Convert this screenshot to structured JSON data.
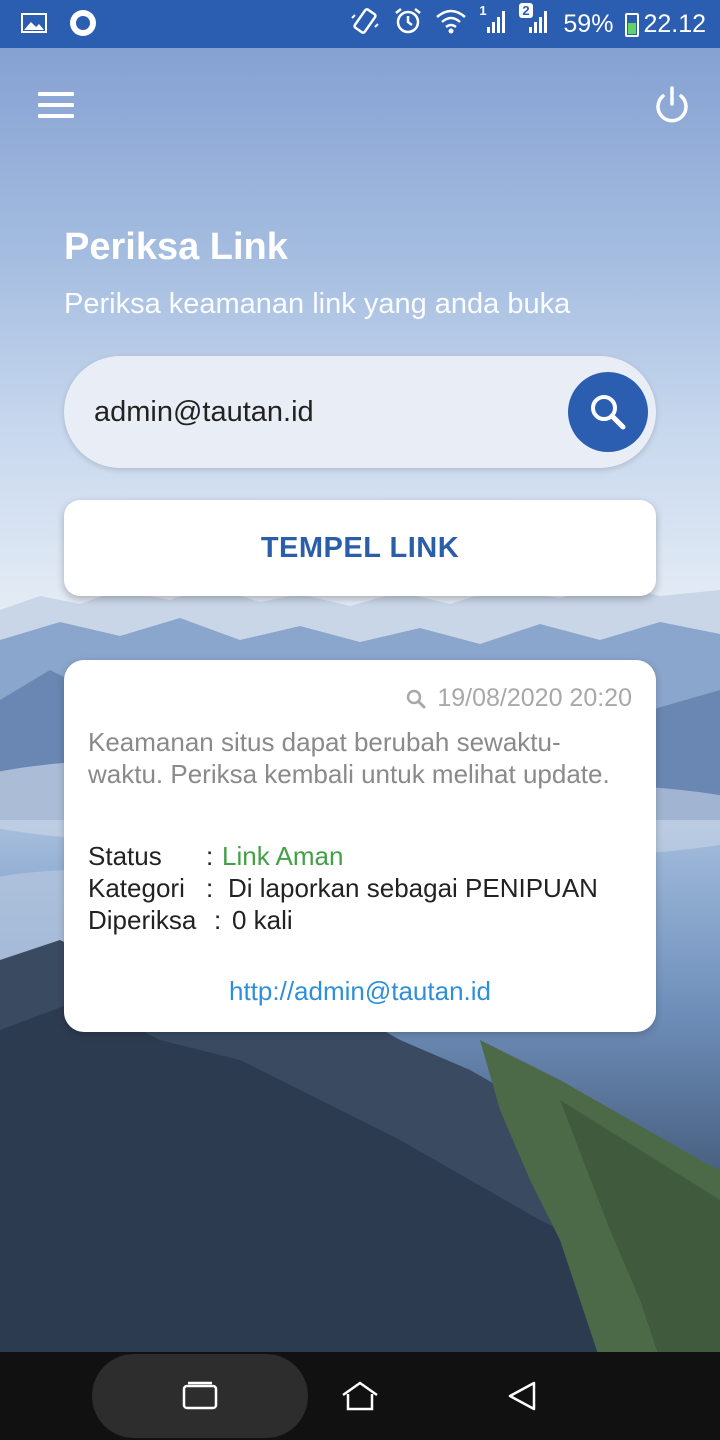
{
  "status_bar": {
    "battery": "59%",
    "time": "22.12",
    "sim_badge_1": "1",
    "sim_badge_2": "2",
    "icons": [
      "image-icon",
      "circle-app-icon",
      "vibrate-icon",
      "alarm-icon",
      "wifi-icon",
      "signal-icon",
      "signal-icon",
      "battery-icon"
    ]
  },
  "app_bar": {
    "menu_icon": "hamburger-menu-icon",
    "power_icon": "power-icon"
  },
  "header": {
    "title": "Periksa Link",
    "subtitle": "Periksa keamanan link yang anda buka"
  },
  "search": {
    "value": "admin@tautan.id",
    "icon": "search-icon"
  },
  "paste_button": {
    "label": "TEMPEL LINK"
  },
  "result_card": {
    "timestamp": "19/08/2020 20:20",
    "note": "Keamanan situs dapat berubah sewaktu-waktu. Periksa kembali untuk melihat update.",
    "rows": [
      {
        "key": "Status",
        "sep": ":",
        "value": "Link Aman"
      },
      {
        "key": "Kategori",
        "sep": ":",
        "value": "Di laporkan sebagai PENIPUAN"
      },
      {
        "key": "Diperiksa",
        "sep": ":",
        "value": "0 kali"
      }
    ],
    "link": "http://admin@tautan.id"
  },
  "colors": {
    "primary": "#2b5db0",
    "safe_status": "#43a047",
    "link": "#2f8fd8"
  },
  "nav_bar": {
    "icons": [
      "recents-icon",
      "home-icon",
      "back-icon"
    ]
  }
}
